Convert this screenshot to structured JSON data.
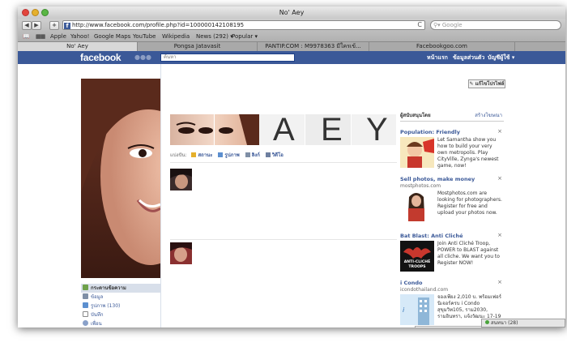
{
  "window": {
    "title": "No' Aey"
  },
  "toolbar": {
    "back": "◀",
    "forward": "▶",
    "add": "+",
    "url": "http://www.facebook.com/profile.php?id=100000142108195",
    "reload": "C",
    "search_placeholder": "Google"
  },
  "bookmarks": [
    "Apple",
    "Yahoo!",
    "Google Maps",
    "YouTube",
    "Wikipedia",
    "News (292) ▾",
    "Popular ▾"
  ],
  "tabs": [
    "No' Aey",
    "Pongsa Jatavasit",
    "PANTIP.COM : M9978363 มีใครเข้...",
    "Facebookgoo.com"
  ],
  "fb": {
    "logo": "facebook",
    "search_placeholder": "ค้นหา",
    "nav": [
      "หน้าแรก",
      "ข้อมูลส่วนตัว",
      "บัญชีผู้ใช้ ▾"
    ]
  },
  "profile": {
    "edit_button": "แก้ไขโปรไฟล์",
    "name_letters": [
      "A",
      "E",
      "Y"
    ],
    "share_label": "แบ่งปัน:",
    "share_items": [
      "สถานะ",
      "รูปภาพ",
      "ลิงก์",
      "วิดีโอ"
    ],
    "left_nav": [
      "กระดานข้อความ",
      "ข้อมูล",
      "รูปภาพ (130)",
      "บันทึก",
      "เพื่อน"
    ]
  },
  "ads": {
    "header": "ผู้สนับสนุนโดย",
    "create": "สร้างโฆษณา",
    "close": "×",
    "items": [
      {
        "title": "Population: Friendly",
        "sub": "",
        "body": "Let Samantha show you how to build your very own metropolis. Play CityVille, Zynga's newest game, now!"
      },
      {
        "title": "Sell photos, make money",
        "sub": "mostphotos.com",
        "body": "Mostphotos.com are looking for photographers. Register for free and upload your photos now."
      },
      {
        "title": "Bat Blast: Anti Cliché",
        "sub": "",
        "body": "Join Anti Cliché Troop, POWER to BLAST against all cliche. We want you to Register NOW!",
        "img_text": "ANTI-CLICHÉ TROOPS"
      },
      {
        "title": "i Condo",
        "sub": "icondothailand.com",
        "body": "จองเพียง 2,010 บ. พร้อมเฟอร์ นิเจอร์ครบ i Condo สุขุมวิท105, ราม2030, รามอินทรา, แจ้งวัฒนะ 17-19"
      }
    ]
  },
  "chat": {
    "label": "สนทนา (28)"
  },
  "colors": {
    "fb_blue": "#3b5998",
    "ad_link": "#3b5998",
    "online": "#4aa43b"
  }
}
